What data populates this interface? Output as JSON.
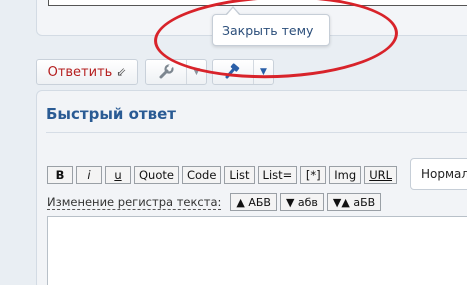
{
  "tooltip": {
    "text": "Закрыть тему"
  },
  "buttons": {
    "reply_label": "Ответить",
    "reply_arrow": "⇙",
    "tools_icon": "wrench-icon",
    "moderation_icon": "gavel-icon",
    "caret": "▼"
  },
  "quick_reply": {
    "title": "Быстрый ответ",
    "toolbar": [
      "B",
      "i",
      "u",
      "Quote",
      "Code",
      "List",
      "List=",
      "[*]",
      "Img",
      "URL"
    ],
    "font_size_select": "Нормал",
    "case_label": "Изменение регистра текста:",
    "case_buttons": [
      "▲ АБВ",
      "▼ абв",
      "▼▲ аБВ"
    ],
    "editor_value": ""
  },
  "colors": {
    "accent": "#2a5b94",
    "reply_text": "#b51f1f",
    "annotation": "#d8232a"
  }
}
